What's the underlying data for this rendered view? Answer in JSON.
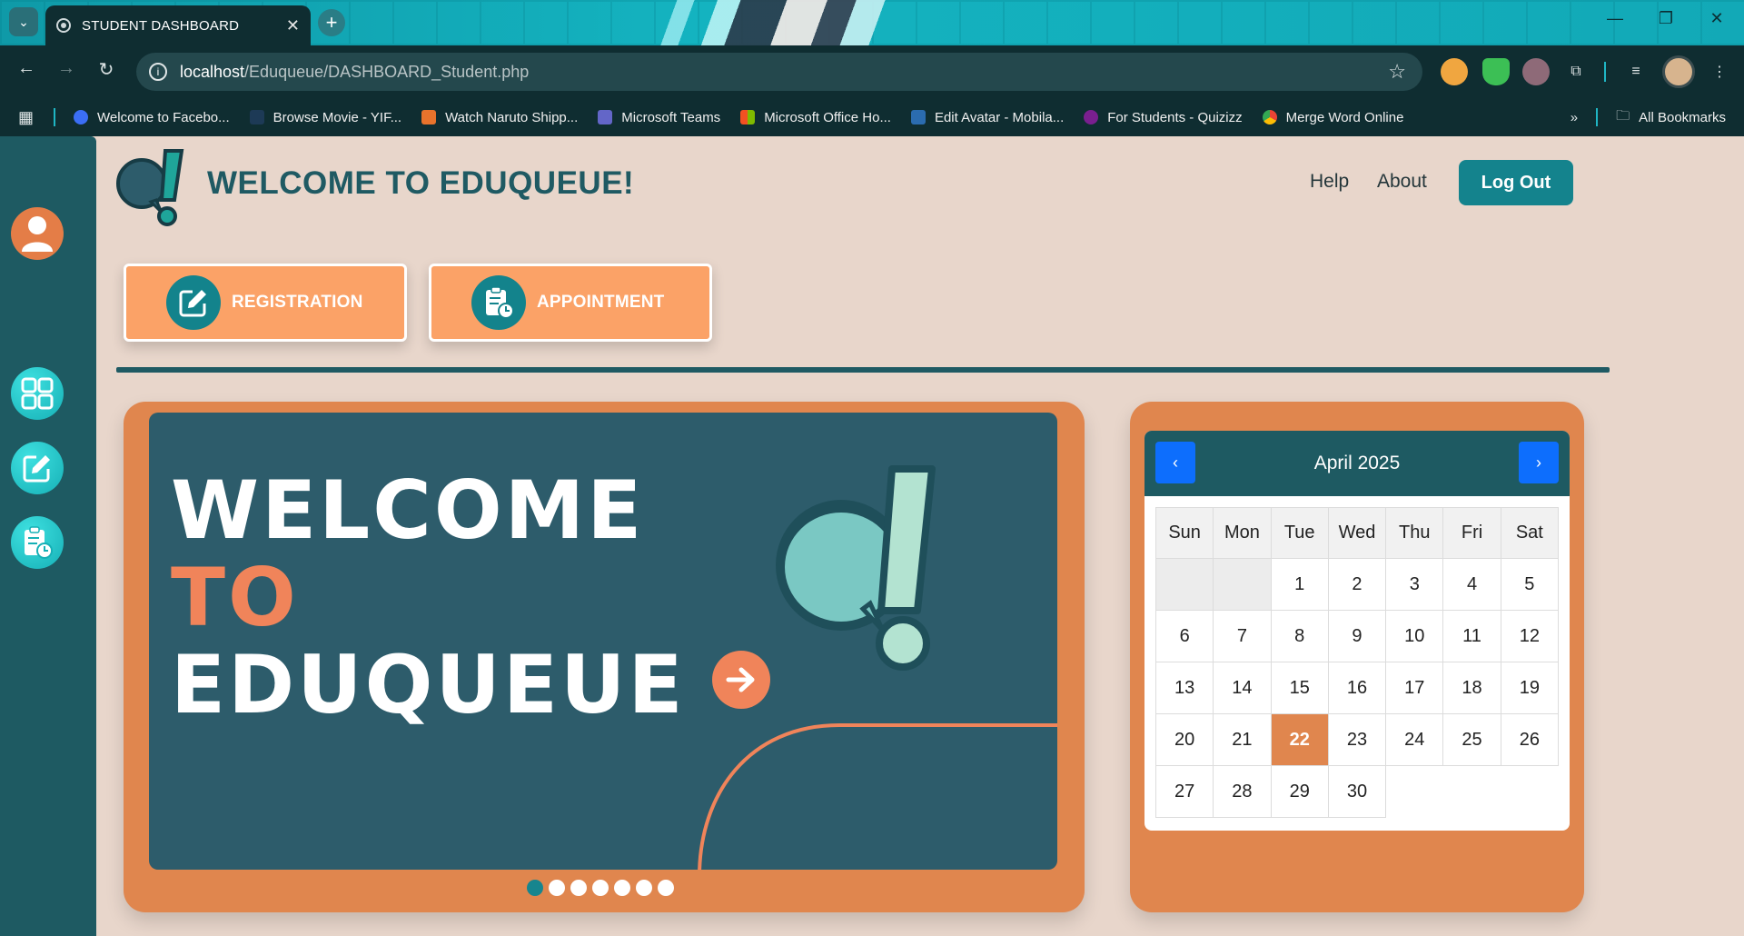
{
  "browser": {
    "tab_title": "STUDENT DASHBOARD",
    "url_host": "localhost",
    "url_path": "/Eduqueue/DASHBOARD_Student.php",
    "bookmarks": [
      "Welcome to Facebo...",
      "Browse Movie - YIF...",
      "Watch Naruto Shipp...",
      "Microsoft Teams",
      "Microsoft Office Ho...",
      "Edit Avatar - Mobila...",
      "For Students - Quizizz",
      "Merge Word Online"
    ],
    "all_bookmarks": "All Bookmarks"
  },
  "header": {
    "title": "WELCOME TO EDUQUEUE!",
    "help": "Help",
    "about": "About",
    "logout": "Log Out"
  },
  "actions": {
    "registration": "REGISTRATION",
    "appointment": "APPOINTMENT"
  },
  "slide": {
    "line1": "WELCOME",
    "line2": "TO",
    "line3": "EDUQUEUE",
    "dots_total": 7,
    "active_dot": 1
  },
  "calendar": {
    "month": "April 2025",
    "weekdays": [
      "Sun",
      "Mon",
      "Tue",
      "Wed",
      "Thu",
      "Fri",
      "Sat"
    ],
    "today": 22,
    "weeks": [
      [
        "",
        "",
        "1",
        "2",
        "3",
        "4",
        "5"
      ],
      [
        "6",
        "7",
        "8",
        "9",
        "10",
        "11",
        "12"
      ],
      [
        "13",
        "14",
        "15",
        "16",
        "17",
        "18",
        "19"
      ],
      [
        "20",
        "21",
        "22",
        "23",
        "24",
        "25",
        "26"
      ],
      [
        "27",
        "28",
        "29",
        "30",
        "",
        "",
        ""
      ]
    ]
  },
  "colors": {
    "teal_dark": "#1f5a63",
    "orange": "#e0864e",
    "button_orange": "#fba267",
    "page_bg": "#e8d6cb"
  }
}
